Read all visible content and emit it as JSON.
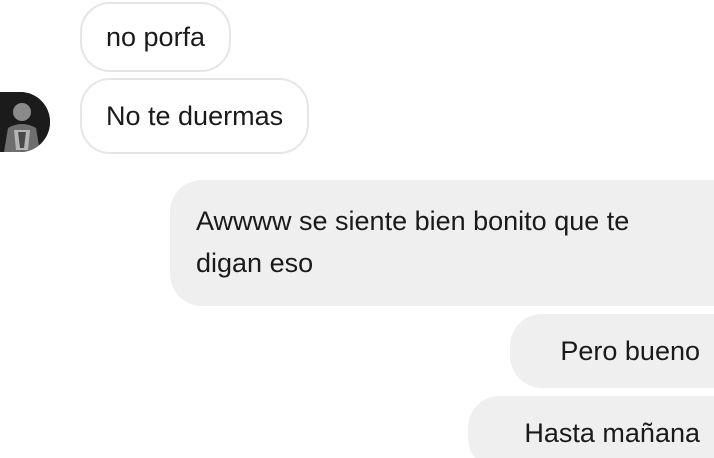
{
  "chat": {
    "messages": [
      {
        "sender": "them",
        "text": "no porfa"
      },
      {
        "sender": "them",
        "text": "No te duermas"
      },
      {
        "sender": "me",
        "text": "Awwww se siente bien bonito que te digan eso"
      },
      {
        "sender": "me",
        "text": "Pero bueno"
      },
      {
        "sender": "me",
        "text": "Hasta mañana"
      }
    ]
  },
  "colors": {
    "incoming_bubble": "#ffffff",
    "incoming_border": "#e6e6e6",
    "outgoing_bubble": "#efefef",
    "text": "#1a1a1a"
  },
  "icons": {
    "avatar": "contact-avatar-icon"
  }
}
